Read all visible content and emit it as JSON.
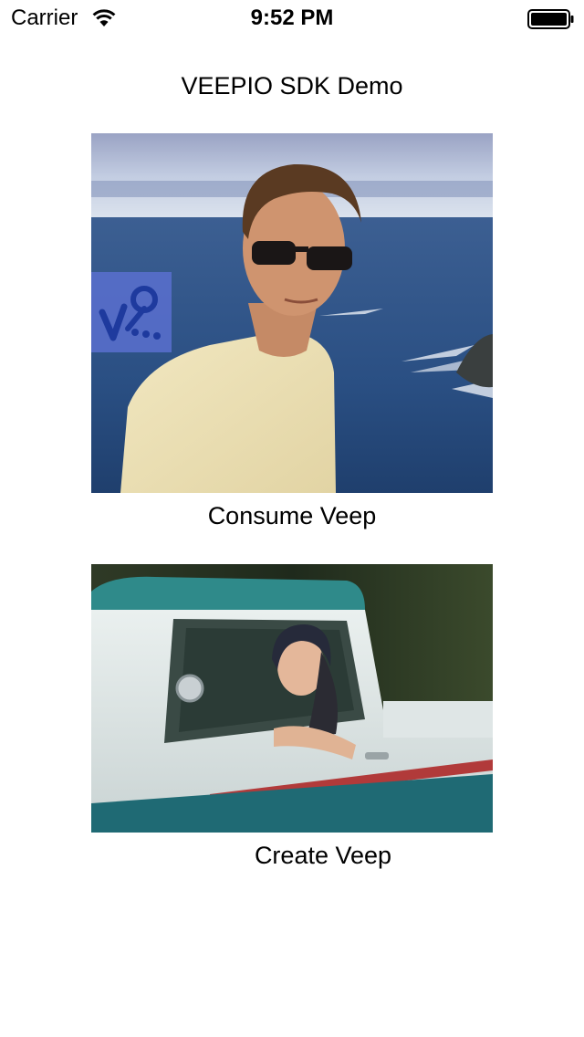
{
  "status_bar": {
    "carrier": "Carrier",
    "time": "9:52 PM",
    "icons": [
      "wifi-icon",
      "battery-icon"
    ]
  },
  "header": {
    "title": "VEEPIO SDK Demo"
  },
  "main": {
    "items": [
      {
        "label": "Consume Veep",
        "image": "man-sunglasses-ocean-photo",
        "badge_icon": "veepio-badge-icon"
      },
      {
        "label": "Create Veep",
        "image": "woman-vintage-truck-photo"
      }
    ]
  },
  "colors": {
    "badge": "#5C70D2",
    "badge_glyph": "#1E3A9E"
  }
}
